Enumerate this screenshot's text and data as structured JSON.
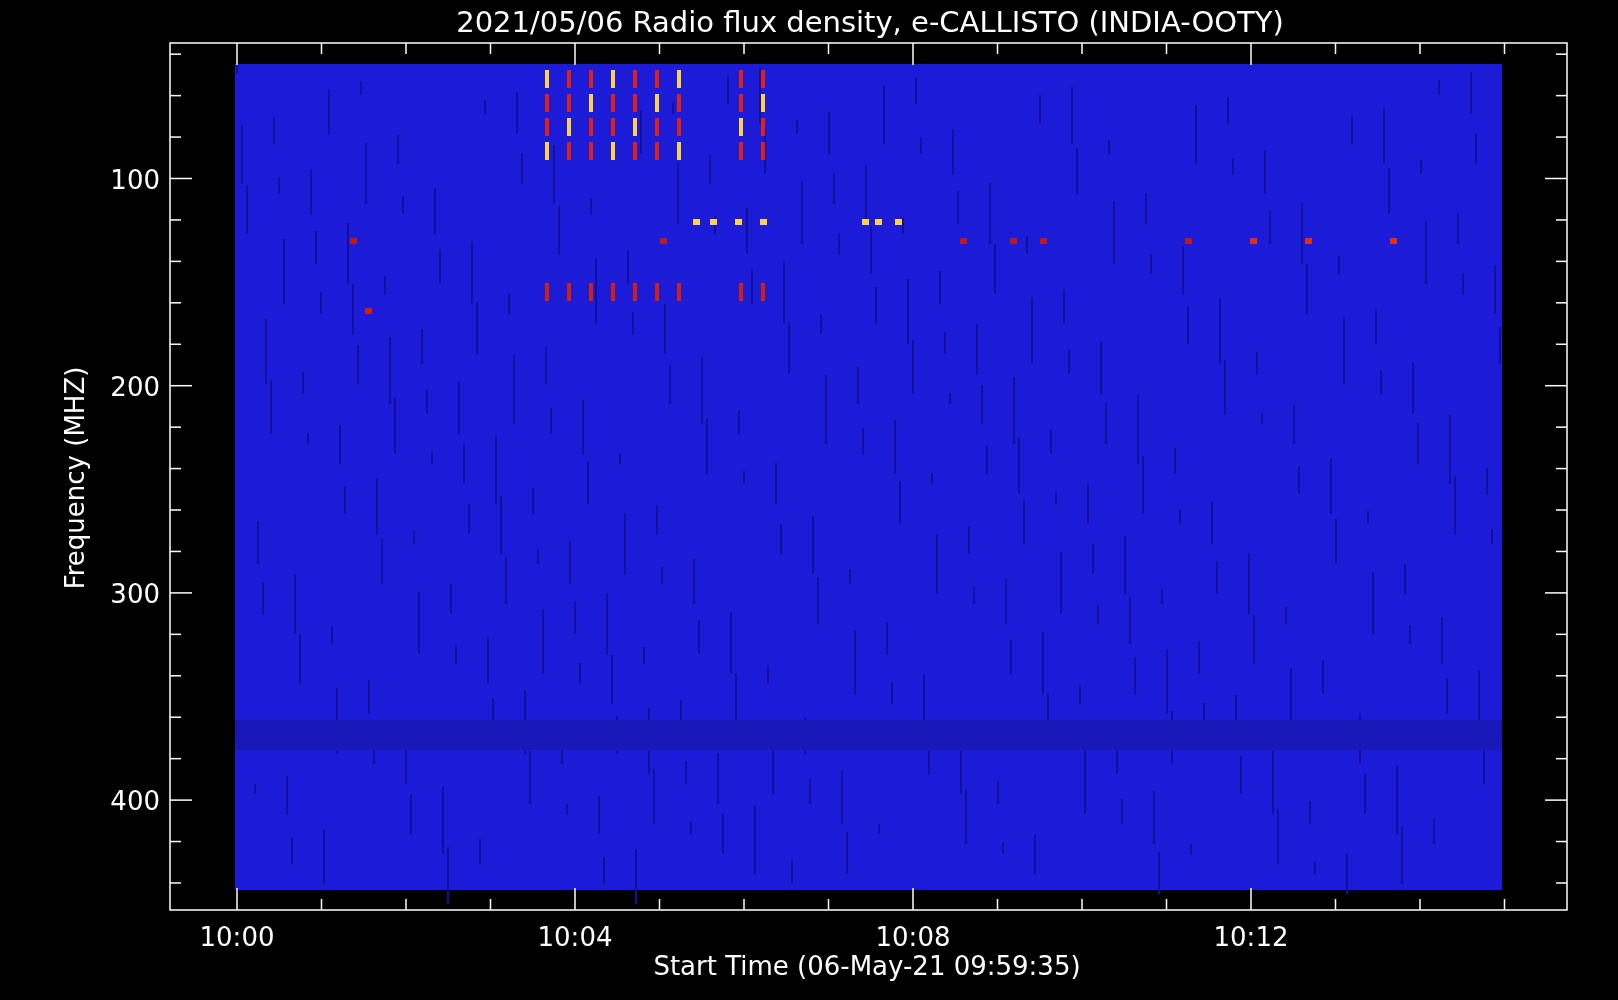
{
  "title": "2021/05/06  Radio flux density, e-CALLISTO (INDIA-OOTY)",
  "plot": {
    "ylabel": "Frequency (MHZ)",
    "xlabel": "Start Time (06-May-21 09:59:35)",
    "yticks": [
      "100",
      "200",
      "300",
      "400"
    ],
    "xticks": [
      "10:00",
      "10:04",
      "10:08",
      "10:12"
    ]
  }
}
